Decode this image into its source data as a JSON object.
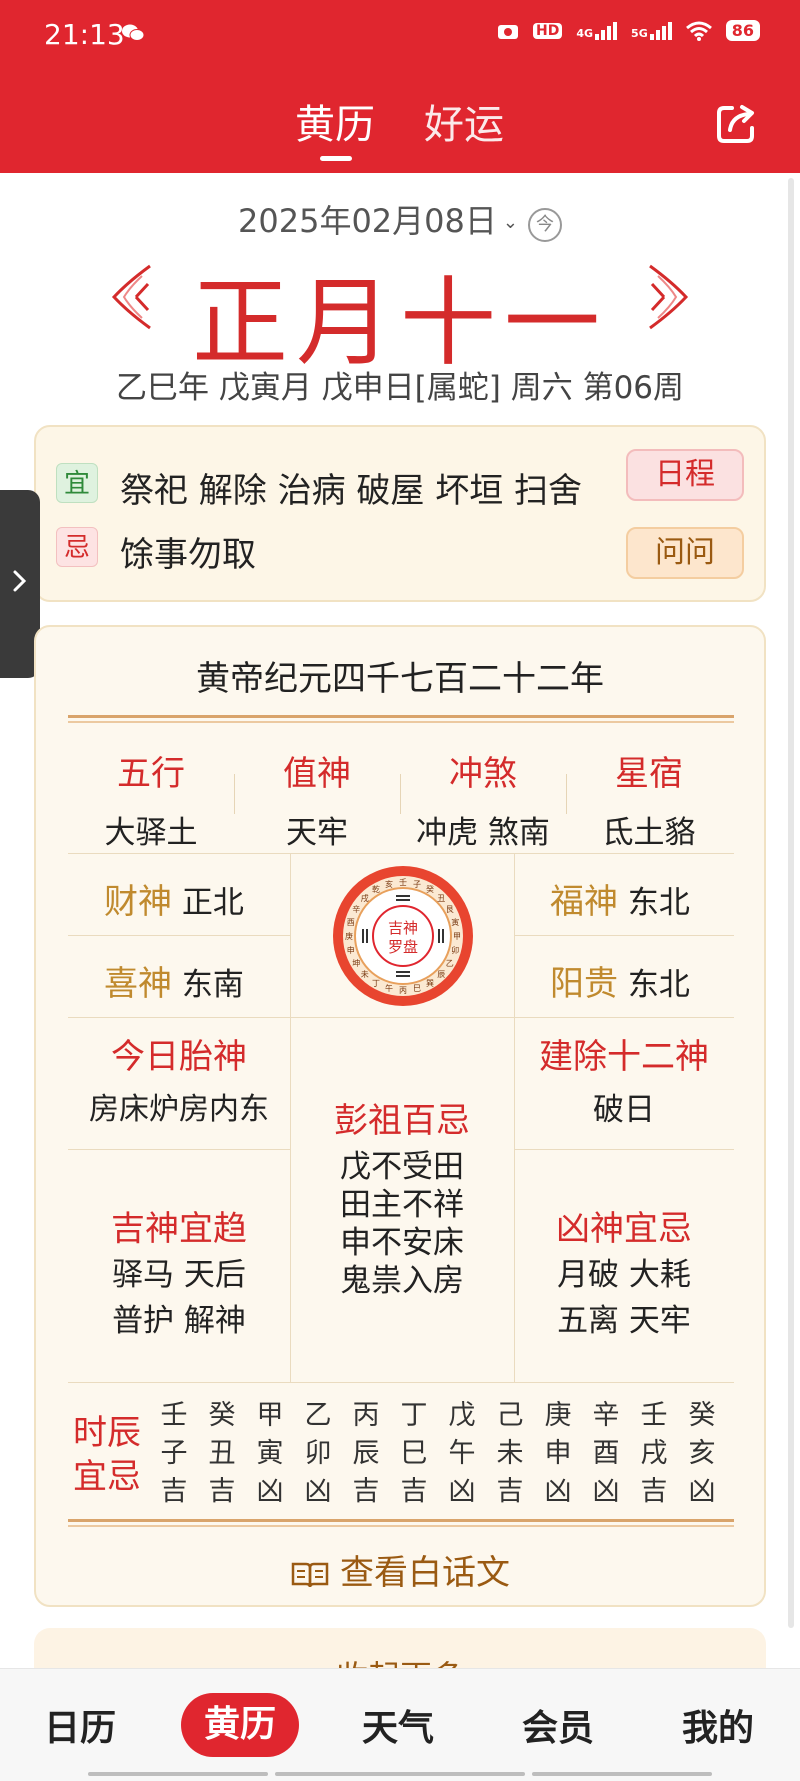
{
  "status_bar": {
    "time": "21:13",
    "hd_label": "HD",
    "net1": "4G",
    "net2": "5G",
    "battery": "86"
  },
  "header": {
    "tabs": [
      {
        "label": "黄历",
        "active": true
      },
      {
        "label": "好运",
        "active": false
      }
    ]
  },
  "date": {
    "solar": "2025年02月08日",
    "today_label": "今",
    "lunar": "正月十一",
    "ganzhi": "乙巳年 戊寅月 戊申日[属蛇] 周六 第06周"
  },
  "yiji": {
    "yi_label": "宜",
    "yi_text": "祭祀 解除 治病 破屋 坏垣 扫舍",
    "ji_label": "忌",
    "ji_text": "馀事勿取",
    "schedule_button": "日程",
    "ask_button": "问问"
  },
  "almanac": {
    "era": "黄帝纪元四千七百二十二年",
    "four": [
      {
        "title": "五行",
        "value": "大驿土"
      },
      {
        "title": "值神",
        "value": "天牢"
      },
      {
        "title": "冲煞",
        "value": "冲虎 煞南"
      },
      {
        "title": "星宿",
        "value": "氐土貉"
      }
    ],
    "caishen": {
      "title": "财神",
      "value": "正北"
    },
    "xishen": {
      "title": "喜神",
      "value": "东南"
    },
    "fushen": {
      "title": "福神",
      "value": "东北"
    },
    "yanggui": {
      "title": "阳贵",
      "value": "东北"
    },
    "compass": {
      "line1": "吉神",
      "line2": "罗盘",
      "ring": [
        "壬",
        "子",
        "癸",
        "丑",
        "艮",
        "寅",
        "甲",
        "卯",
        "乙",
        "辰",
        "巽",
        "巳",
        "丙",
        "午",
        "丁",
        "未",
        "坤",
        "申",
        "庚",
        "酉",
        "辛",
        "戌",
        "乾",
        "亥"
      ]
    },
    "taishen": {
      "title": "今日胎神",
      "value": "房床炉房内东"
    },
    "jianchu": {
      "title": "建除十二神",
      "value": "破日"
    },
    "pengzu": {
      "title": "彭祖百忌",
      "lines": [
        "戊不受田",
        "田主不祥",
        "申不安床",
        "鬼祟入房"
      ]
    },
    "jishen": {
      "title": "吉神宜趋",
      "line1": "驿马 天后",
      "line2": "普护 解神"
    },
    "xiongshen": {
      "title": "凶神宜忌",
      "line1": "月破 大耗",
      "line2": "五离 天牢"
    },
    "hours": {
      "label1": "时辰",
      "label2": "宜忌",
      "columns": [
        {
          "stem": "壬",
          "branch": "子",
          "luck": "吉"
        },
        {
          "stem": "癸",
          "branch": "丑",
          "luck": "吉"
        },
        {
          "stem": "甲",
          "branch": "寅",
          "luck": "凶"
        },
        {
          "stem": "乙",
          "branch": "卯",
          "luck": "凶"
        },
        {
          "stem": "丙",
          "branch": "辰",
          "luck": "吉"
        },
        {
          "stem": "丁",
          "branch": "巳",
          "luck": "吉"
        },
        {
          "stem": "戊",
          "branch": "午",
          "luck": "凶"
        },
        {
          "stem": "己",
          "branch": "未",
          "luck": "吉"
        },
        {
          "stem": "庚",
          "branch": "申",
          "luck": "凶"
        },
        {
          "stem": "辛",
          "branch": "酉",
          "luck": "凶"
        },
        {
          "stem": "壬",
          "branch": "戌",
          "luck": "吉"
        },
        {
          "stem": "癸",
          "branch": "亥",
          "luck": "凶"
        }
      ]
    },
    "baihua_link": "查看白话文"
  },
  "collapse_label": "收起更多",
  "bottom_nav": [
    {
      "label": "日历"
    },
    {
      "label": "黄历",
      "active": true
    },
    {
      "label": "天气"
    },
    {
      "label": "会员"
    },
    {
      "label": "我的"
    }
  ],
  "colors": {
    "brand_red": "#e0262f",
    "lunar_red": "#d42b2b",
    "gold": "#c08a2e",
    "card_bg": "#fdf8ee"
  }
}
